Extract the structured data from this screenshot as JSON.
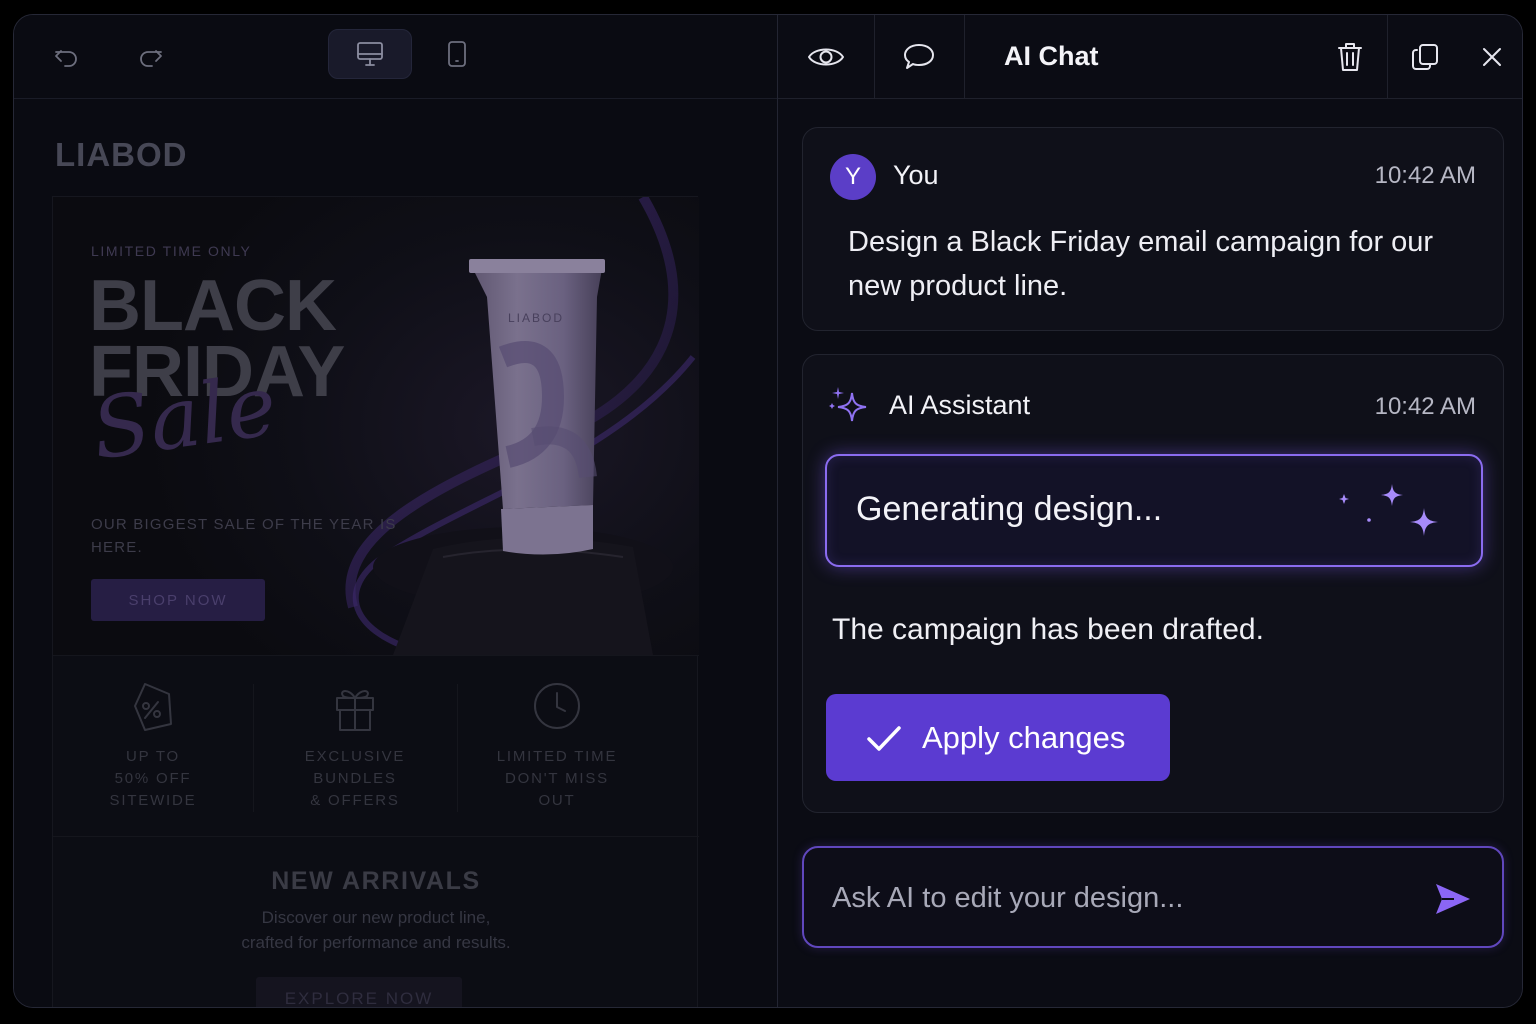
{
  "editor": {
    "toolbar": {
      "undo_icon": "undo-icon",
      "redo_icon": "redo-icon",
      "desktop_icon": "desktop-icon",
      "mobile_icon": "mobile-icon",
      "active_view": "desktop"
    },
    "email": {
      "brand": "LIABOD",
      "hero": {
        "kicker": "LIMITED TIME ONLY",
        "title_line1": "BLACK",
        "title_line2": "FRIDAY",
        "script": "Sale",
        "subtitle": "OUR BIGGEST SALE OF THE YEAR IS HERE.",
        "button": "SHOP NOW",
        "product_label": "LIABOD"
      },
      "features": [
        {
          "icon": "percent-tag-icon",
          "text": "UP TO\n50% OFF\nSITEWIDE"
        },
        {
          "icon": "gift-icon",
          "text": "EXCLUSIVE\nBUNDLES\n& OFFERS"
        },
        {
          "icon": "clock-icon",
          "text": "LIMITED TIME\nDON'T MISS\nOUT"
        }
      ],
      "arrivals": {
        "title": "NEW ARRIVALS",
        "text": "Discover our new product line,\ncrafted for performance and results.",
        "button": "EXPLORE NOW"
      }
    }
  },
  "chat": {
    "title": "AI Chat",
    "header_icons": [
      "eye-icon",
      "comment-icon",
      "trash-icon",
      "copy-icon",
      "close-icon"
    ],
    "messages": [
      {
        "author": "You",
        "avatar_initial": "Y",
        "time": "10:42 AM",
        "text": "Design a Black Friday email campaign for our new product line."
      },
      {
        "author": "AI Assistant",
        "time": "10:42 AM",
        "status": "Generating design...",
        "text": "The campaign has been drafted.",
        "action": "Apply changes"
      }
    ],
    "input": {
      "placeholder": "Ask AI to edit your design...",
      "value": ""
    }
  },
  "colors": {
    "accent": "#5b3bd1",
    "accent_glow": "#8b6cf0",
    "avatar": "#5b3ec7",
    "background": "#0b0c14"
  }
}
